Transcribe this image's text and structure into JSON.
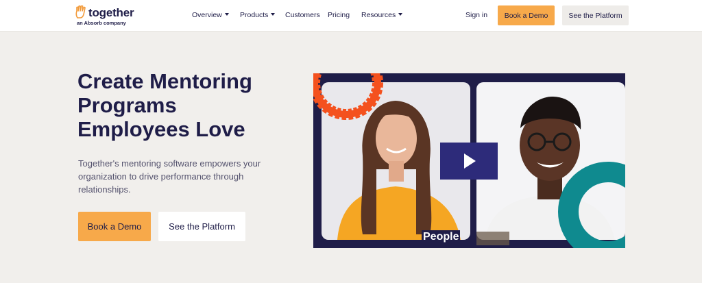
{
  "brand": {
    "name": "together",
    "tagline": "an Absorb company",
    "icon": "hand-logo-icon",
    "color_primary": "#1f1d48",
    "color_accent": "#f7a94a",
    "color_logo": "#f29a3a"
  },
  "nav": {
    "items": [
      {
        "label": "Overview",
        "dropdown": true
      },
      {
        "label": "Products",
        "dropdown": true
      },
      {
        "label": "Customers",
        "dropdown": false
      },
      {
        "label": "Pricing",
        "dropdown": false
      },
      {
        "label": "Resources",
        "dropdown": true
      }
    ],
    "signin": "Sign in",
    "demo": "Book a Demo",
    "platform": "See the Platform"
  },
  "hero": {
    "title_lines": [
      "Create Mentoring",
      "Programs",
      "Employees Love"
    ],
    "subtitle": "Together's mentoring software empowers your organization to drive performance through relationships.",
    "cta_primary": "Book a Demo",
    "cta_secondary": "See the Platform"
  },
  "video": {
    "caption": "People",
    "play_icon": "play-icon",
    "colors": {
      "frame": "#1f1d48",
      "play_bg": "#2d2b7a",
      "shape_red": "#f4511e",
      "shape_teal": "#0f8a8f",
      "shirt_orange": "#f5a623"
    }
  }
}
